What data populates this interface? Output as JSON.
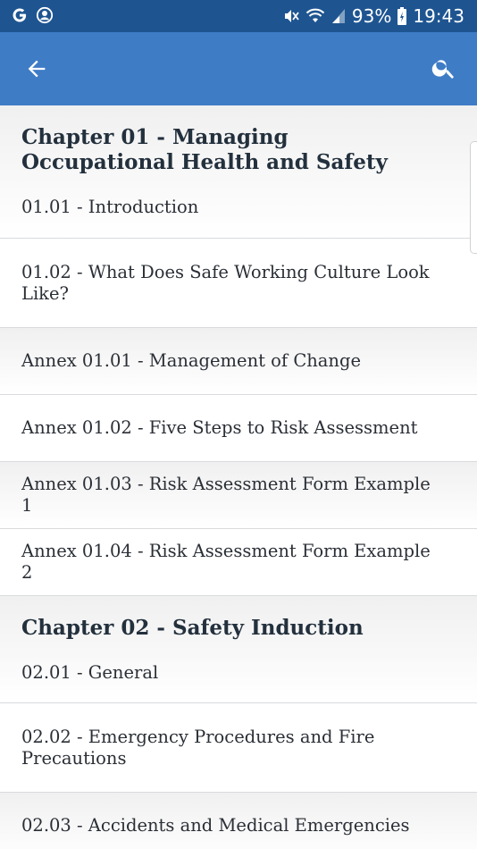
{
  "status_bar": {
    "time": "19:43",
    "battery": "93%",
    "icons": [
      "google-icon",
      "account-icon",
      "mute-icon",
      "wifi-icon",
      "signal-icon",
      "battery-icon"
    ]
  },
  "toolbar": {
    "back_icon": "arrow-back-icon",
    "search_icon": "search-icon"
  },
  "list": {
    "items": [
      {
        "chapter": "Chapter 01 - Managing Occupational Health and Safety",
        "label": "01.01 - Introduction"
      },
      {
        "label": "01.02 - What Does Safe Working Culture Look Like?"
      },
      {
        "label": "Annex 01.01 - Management of Change"
      },
      {
        "label": "Annex 01.02 - Five Steps to Risk Assessment"
      },
      {
        "label": "Annex 01.03 - Risk Assessment Form Example 1"
      },
      {
        "label": "Annex 01.04 - Risk Assessment Form Example 2"
      },
      {
        "chapter": "Chapter 02 - Safety Induction",
        "label": "02.01 - General"
      },
      {
        "label": "02.02 - Emergency Procedures and Fire Precautions"
      },
      {
        "label": "02.03 - Accidents and Medical Emergencies"
      }
    ]
  },
  "colors": {
    "status_bar": "#1e5591",
    "toolbar": "#3f7cc6",
    "text": "#2a2f36"
  }
}
